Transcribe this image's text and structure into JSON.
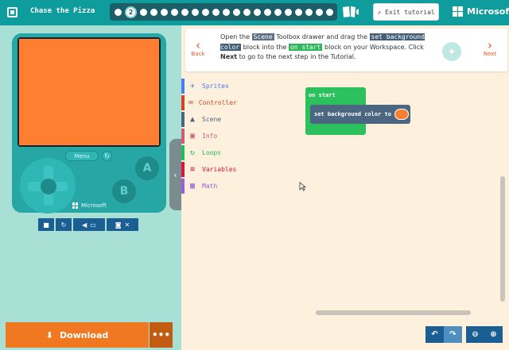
{
  "header": {
    "title": "Chase the Pizza",
    "steps": [
      1,
      2,
      3,
      4,
      5,
      6,
      7,
      8,
      9,
      10,
      11,
      12,
      13,
      14,
      15,
      16,
      17,
      18,
      19,
      20,
      21
    ],
    "current_step": "2",
    "exit_label": "Exit tutorial",
    "brand": "Microsoft"
  },
  "simulator": {
    "screen_color": "#ff7f32",
    "menu_label": "Menu",
    "btn_a": "A",
    "btn_b": "B",
    "brand": "Microsoft"
  },
  "download": {
    "label": "Download",
    "more": "•••"
  },
  "tutorial": {
    "back": "Back",
    "next": "Next",
    "t1": "Open the ",
    "scene_tag": "Scene",
    "t2": " Toolbox drawer and drag the ",
    "block_tag": "set background color",
    "t3": " block into the ",
    "start_tag": "on start",
    "t4": " block on your Workspace. Click ",
    "next_word": "Next",
    "t5": " to go to the next step in the Tutorial."
  },
  "toolbox": {
    "items": [
      {
        "label": "Sprites",
        "color": "#4b7bec",
        "icon": "✈"
      },
      {
        "label": "Controller",
        "color": "#d54322",
        "icon": "∞"
      },
      {
        "label": "Scene",
        "color": "#4b6680",
        "icon": "▲"
      },
      {
        "label": "Info",
        "color": "#cf5b7a",
        "icon": "▣"
      },
      {
        "label": "Loops",
        "color": "#20bf55",
        "icon": "↻"
      },
      {
        "label": "Variables",
        "color": "#dc143c",
        "icon": "≡"
      },
      {
        "label": "Math",
        "color": "#9c5fd6",
        "icon": "▦"
      }
    ]
  },
  "workspace": {
    "on_start": "on start",
    "set_bg": "set background color to",
    "swatch_color": "#ff7f32"
  }
}
